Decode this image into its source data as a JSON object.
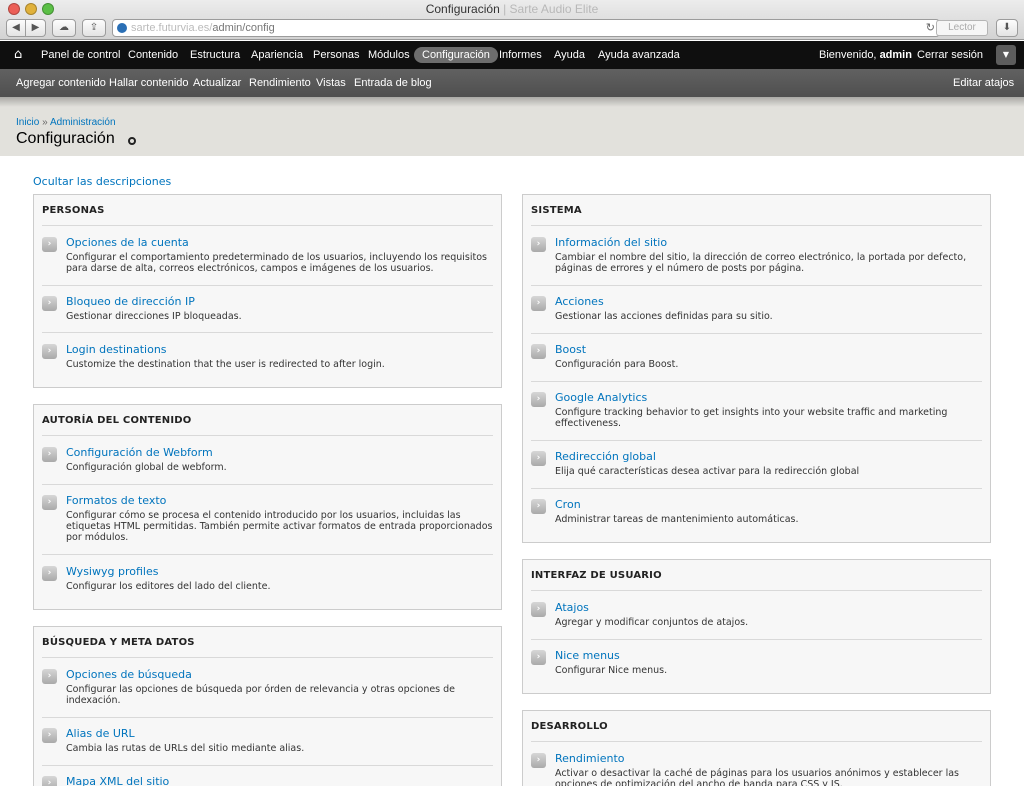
{
  "window": {
    "title": "Configuración",
    "title_suffix": "| Sarte Audio Elite",
    "url_host": "sarte.futurvia.es/",
    "url_path": "admin/config",
    "reader_label": "Lector"
  },
  "toolbar": {
    "items": [
      "Panel de control",
      "Contenido",
      "Estructura",
      "Apariencia",
      "Personas",
      "Módulos",
      "Configuración",
      "Informes",
      "Ayuda",
      "Ayuda avanzada"
    ],
    "welcome_prefix": "Bienvenido,",
    "welcome_user": "admin",
    "logout": "Cerrar sesión"
  },
  "shortcuts": {
    "items": [
      "Agregar contenido",
      "Hallar contenido",
      "Actualizar",
      "Rendimiento",
      "Vistas",
      "Entrada de blog"
    ],
    "edit": "Editar atajos"
  },
  "breadcrumb": {
    "home": "Inicio",
    "sep": "»",
    "admin": "Administración"
  },
  "page_title": "Configuración",
  "hide_descriptions": "Ocultar las descripciones",
  "panels": {
    "personas": {
      "title": "PERSONAS",
      "entries": [
        {
          "link": "Opciones de la cuenta",
          "desc": "Configurar el comportamiento predeterminado de los usuarios, incluyendo los requisitos para darse de alta, correos electrónicos, campos e imágenes de los usuarios."
        },
        {
          "link": "Bloqueo de dirección IP",
          "desc": "Gestionar direcciones IP bloqueadas."
        },
        {
          "link": "Login destinations",
          "desc": "Customize the destination that the user is redirected to after login."
        }
      ]
    },
    "autoria": {
      "title": "AUTORÍA DEL CONTENIDO",
      "entries": [
        {
          "link": "Configuración de Webform",
          "desc": "Configuración global de webform."
        },
        {
          "link": "Formatos de texto",
          "desc": "Configurar cómo se procesa el contenido introducido por los usuarios, incluidas las etiquetas HTML permitidas. También permite activar formatos de entrada proporcionados por módulos."
        },
        {
          "link": "Wysiwyg profiles",
          "desc": "Configurar los editores del lado del cliente."
        }
      ]
    },
    "busqueda": {
      "title": "BÚSQUEDA Y META DATOS",
      "entries": [
        {
          "link": "Opciones de búsqueda",
          "desc": "Configurar las opciones de búsqueda por órden de relevancia y otras opciones de indexación."
        },
        {
          "link": "Alias de URL",
          "desc": "Cambia las rutas de URLs del sitio mediante alias."
        },
        {
          "link": "Mapa XML del sitio",
          "desc": ""
        }
      ]
    },
    "sistema": {
      "title": "SISTEMA",
      "entries": [
        {
          "link": "Información del sitio",
          "desc": "Cambiar el nombre del sitio, la dirección de correo electrónico, la portada por defecto, páginas de errores y el número de posts por página."
        },
        {
          "link": "Acciones",
          "desc": "Gestionar las acciones definidas para su sitio."
        },
        {
          "link": "Boost",
          "desc": "Configuración para Boost."
        },
        {
          "link": "Google Analytics",
          "desc": "Configure tracking behavior to get insights into your website traffic and marketing effectiveness."
        },
        {
          "link": "Redirección global",
          "desc": "Elija qué características desea activar para la redirección global"
        },
        {
          "link": "Cron",
          "desc": "Administrar tareas de mantenimiento automáticas."
        }
      ]
    },
    "interfaz": {
      "title": "INTERFAZ DE USUARIO",
      "entries": [
        {
          "link": "Atajos",
          "desc": "Agregar y modificar conjuntos de atajos."
        },
        {
          "link": "Nice menus",
          "desc": "Configurar Nice menus."
        }
      ]
    },
    "desarrollo": {
      "title": "DESARROLLO",
      "entries": [
        {
          "link": "Rendimiento",
          "desc": "Activar o desactivar la caché de páginas para los usuarios anónimos y establecer las opciones de optimización del ancho de banda para CSS y JS."
        }
      ]
    }
  }
}
